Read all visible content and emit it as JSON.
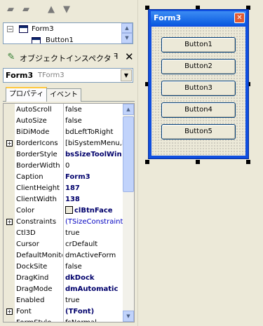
{
  "toolbar": {
    "icons": [
      "open-folder-icon",
      "new-folder-icon",
      "arrow-up-icon",
      "arrow-down-icon"
    ]
  },
  "tree": {
    "items": [
      {
        "label": "Form3"
      },
      {
        "label": "Button1"
      }
    ]
  },
  "inspector": {
    "title": "オブジェクトインスペクタ",
    "pin": "ꟻ",
    "close": "✕",
    "object_name": "Form3",
    "object_type": "TForm3",
    "tabs": [
      {
        "label": "プロパティ"
      },
      {
        "label": "イベント"
      }
    ],
    "properties": [
      {
        "name": "AutoScroll",
        "value": "false",
        "style": "normal",
        "expander": ""
      },
      {
        "name": "AutoSize",
        "value": "false",
        "style": "normal",
        "expander": ""
      },
      {
        "name": "BiDiMode",
        "value": "bdLeftToRight",
        "style": "normal",
        "expander": ""
      },
      {
        "name": "BorderIcons",
        "value": "[biSystemMenu,b",
        "style": "normal",
        "expander": "+"
      },
      {
        "name": "BorderStyle",
        "value": "bsSizeToolWin",
        "style": "bold",
        "expander": ""
      },
      {
        "name": "BorderWidth",
        "value": "0",
        "style": "normal",
        "expander": ""
      },
      {
        "name": "Caption",
        "value": "Form3",
        "style": "bold",
        "expander": ""
      },
      {
        "name": "ClientHeight",
        "value": "187",
        "style": "bold",
        "expander": ""
      },
      {
        "name": "ClientWidth",
        "value": "138",
        "style": "bold",
        "expander": ""
      },
      {
        "name": "Color",
        "value": "clBtnFace",
        "style": "bold",
        "expander": "",
        "swatch": "#ece9d8"
      },
      {
        "name": "Constraints",
        "value": "(TSizeConstraints",
        "style": "blue",
        "expander": "+"
      },
      {
        "name": "Ctl3D",
        "value": "true",
        "style": "normal",
        "expander": ""
      },
      {
        "name": "Cursor",
        "value": "crDefault",
        "style": "normal",
        "expander": ""
      },
      {
        "name": "DefaultMonito",
        "value": "dmActiveForm",
        "style": "normal",
        "expander": ""
      },
      {
        "name": "DockSite",
        "value": "false",
        "style": "normal",
        "expander": ""
      },
      {
        "name": "DragKind",
        "value": "dkDock",
        "style": "bold",
        "expander": ""
      },
      {
        "name": "DragMode",
        "value": "dmAutomatic",
        "style": "bold",
        "expander": ""
      },
      {
        "name": "Enabled",
        "value": "true",
        "style": "normal",
        "expander": ""
      },
      {
        "name": "Font",
        "value": "(TFont)",
        "style": "bold",
        "expander": "+"
      },
      {
        "name": "FormStyle",
        "value": "fsNormal",
        "style": "normal",
        "expander": ""
      }
    ]
  },
  "form": {
    "title": "Form3",
    "close_glyph": "✕",
    "buttons": [
      {
        "label": "Button1"
      },
      {
        "label": "Button2"
      },
      {
        "label": "Button3"
      },
      {
        "label": "Button4"
      },
      {
        "label": "Button5"
      }
    ]
  },
  "colors": {
    "title_gradient_top": "#3c8cf4",
    "frame": "#0f4fe0",
    "tab_highlight": "#ffc83c"
  }
}
